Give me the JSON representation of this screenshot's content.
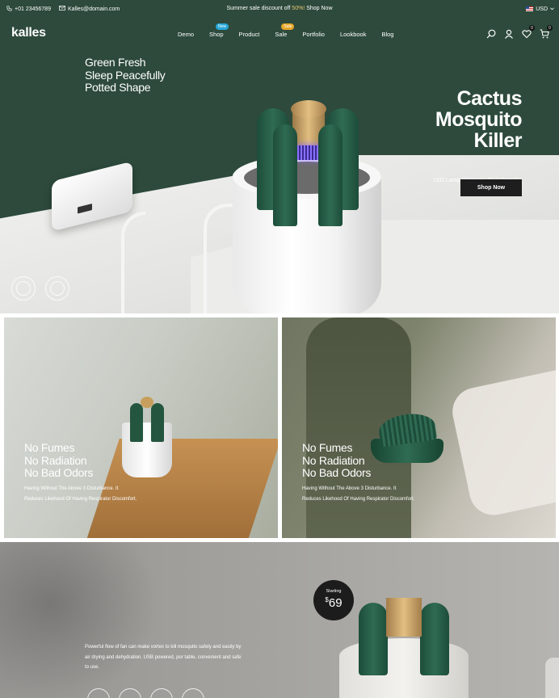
{
  "topbar": {
    "phone": "+01 23456789",
    "email": "Kalles@domain.com",
    "announcement_prefix": "Summer sale discount off ",
    "announcement_highlight": "50%!",
    "announcement_suffix": " Shop Now",
    "currency": "USD"
  },
  "header": {
    "logo": "kalles",
    "nav": [
      {
        "label": "Demo",
        "tag": ""
      },
      {
        "label": "Shop",
        "tag": "New",
        "tag_color": "#26a6d6"
      },
      {
        "label": "Product",
        "tag": ""
      },
      {
        "label": "Sale",
        "tag": "Sale",
        "tag_color": "#e6a72a"
      },
      {
        "label": "Portfolio",
        "tag": ""
      },
      {
        "label": "Lookbook",
        "tag": ""
      },
      {
        "label": "Blog",
        "tag": ""
      }
    ],
    "wishlist_count": "0",
    "cart_count": "0",
    "icons": [
      "search-icon",
      "user-icon",
      "heart-icon",
      "cart-icon"
    ]
  },
  "hero": {
    "title_lines": [
      "Cactus",
      "Mosquito",
      "Killer"
    ],
    "subtitle": "LED Lamp Electronic Pest Repeller",
    "button": "Shop Now",
    "bg_color": "#2d4a3c"
  },
  "features": [
    {
      "title_lines": [
        "No Fumes",
        "No Radiation",
        "No Bad Odors"
      ],
      "text": "Having Without The Above 3 Disturbance. It Reduces Likehood Of Having Respirator Discomfort."
    },
    {
      "title_lines": [
        "No Fumes",
        "No Radiation",
        "No Bad Odors"
      ],
      "text": "Having Without The Above 3 Disturbance. It Reduces Likehood Of Having Respirator Discomfort."
    }
  ],
  "promo": {
    "title_lines": [
      "Green Fresh",
      "Sleep Peacefully",
      "Potted Shape"
    ],
    "text": "Powerful flow of fan can make vortex to kill mosquito safely and easily by air drying and dehydration. USB powered, por table, convenient and safe to use.",
    "starting_label": "Starting",
    "currency_symbol": "$",
    "price": "69"
  }
}
